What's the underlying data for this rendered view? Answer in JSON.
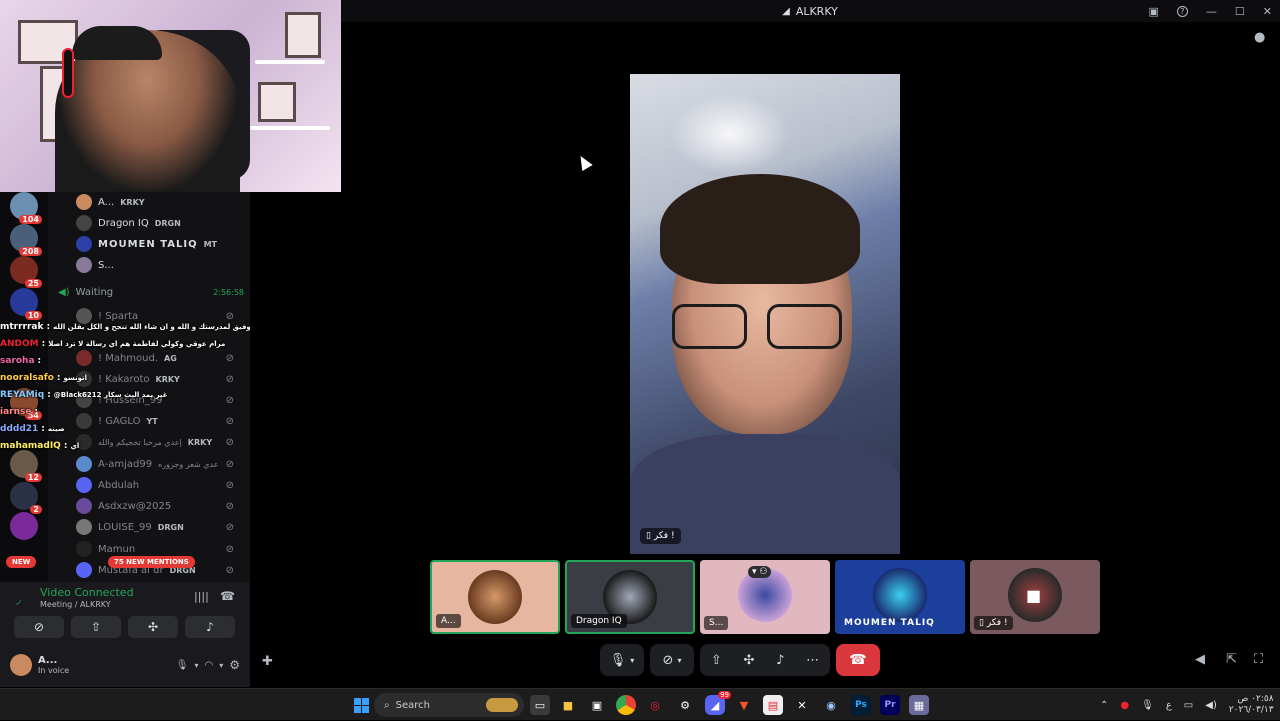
{
  "window": {
    "title": "ALKRKY",
    "app_icon": "discord-icon"
  },
  "sidebar": {
    "server_badges": [
      "104",
      "208",
      "25",
      "10",
      "54",
      "12",
      "2"
    ],
    "voice_users": [
      {
        "name": "A...",
        "tag": "KRKY"
      },
      {
        "name": "Dragon IQ",
        "tag": "DRGN"
      },
      {
        "name": "MOUMEN TALIQ",
        "tag": "MT"
      },
      {
        "name": "S..."
      }
    ],
    "waiting_channel": {
      "label": "Waiting",
      "time": "2:56:58"
    },
    "waiting_users": [
      {
        "name": "! Sparta"
      },
      {
        "name": "! Mahmoud.",
        "tag": "AG"
      },
      {
        "name": "! Kakaroto",
        "tag": "KRKY"
      },
      {
        "name": "! Hussein_99"
      },
      {
        "name": "! GAGLO",
        "tag": "YT"
      },
      {
        "name": "إعدي مرحبا تحجيكم والله",
        "tag": "KRKY"
      },
      {
        "name": "A-amjad99",
        "note": "عدي شعر وجزوره"
      },
      {
        "name": "Abdulah"
      },
      {
        "name": "Asdxzw@2025"
      },
      {
        "name": "LOUISE_99",
        "tag": "DRGN"
      },
      {
        "name": "Mamun"
      },
      {
        "name": "Mustafa al dr",
        "tag": "DRGN"
      }
    ],
    "new_badge": "NEW",
    "mentions_badge": "75 NEW MENTIONS"
  },
  "chat_overlay": [
    {
      "user": "mtrrrrak",
      "text": "كل التوفيق لمدرستك و الله و ان شاء الله تنجح و الكل يقلن الله"
    },
    {
      "user": "ANDOM",
      "text": "مرام عوقي وكولي لفاطمة هم اي رسالة لا ترد اصلا"
    },
    {
      "user": "saroha",
      "text": ""
    },
    {
      "user": "nooralsafo",
      "text": "اتونسو"
    },
    {
      "user": "REYAMiq",
      "text": "@Black6212 غير يمد البث سكار"
    },
    {
      "user": "iarnse",
      "text": ""
    },
    {
      "user": "dddd21",
      "text": "صينه"
    },
    {
      "user": "mahamadIQ",
      "text": "اي"
    }
  ],
  "voice_panel": {
    "status": "Video Connected",
    "channel": "Meeting / ALKRKY",
    "user_name": "A...",
    "user_status": "In voice"
  },
  "main_video": {
    "label": "فكر !"
  },
  "tiles": [
    {
      "label": "A...",
      "active": true,
      "bg": "#e6b6a0"
    },
    {
      "label": "Dragon IQ",
      "active": true,
      "bg": "#3a3d44"
    },
    {
      "label": "S...",
      "active": false,
      "bg": "#e2b8c0"
    },
    {
      "label": "MOUMEN TALIQ",
      "active": false,
      "bg": "#1b3f9a"
    },
    {
      "label": "فكر !",
      "active": false,
      "bg": "#7a5a5e"
    }
  ],
  "taskbar": {
    "search_placeholder": "Search",
    "clock_time": "٠٢:٥٨ ص",
    "clock_date": "٢٠٢٦/٠٣/١٣",
    "discord_badge": "99"
  }
}
